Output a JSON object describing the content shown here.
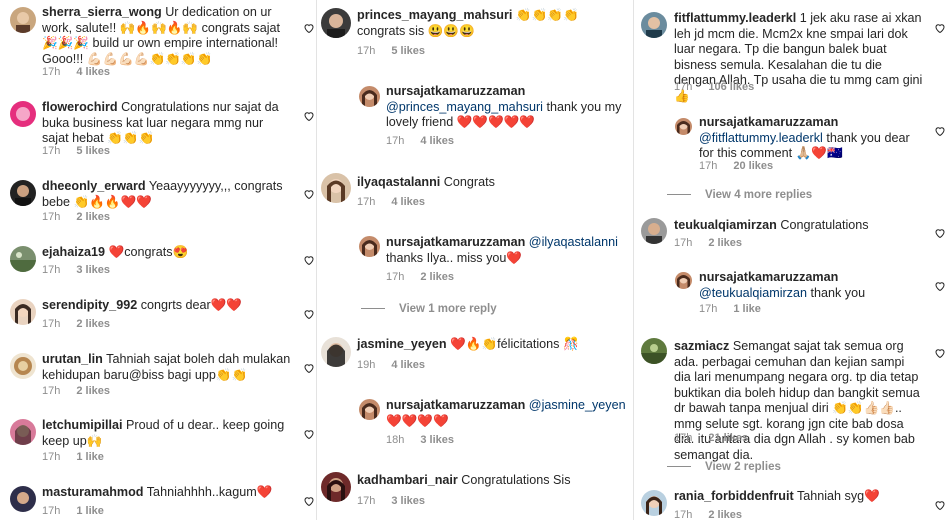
{
  "colors": {
    "text": "#262626",
    "secondary": "#8e8e8e",
    "mention": "#00376b",
    "emoji_heart": "#e0245e"
  },
  "col1": [
    {
      "user": "sherra_sierra_wong",
      "text": "Ur dedication on ur work, salute!! 🙌🔥🙌🔥🙌 congrats sajat 🎉🎉🎉 build ur own empire international! Gooo!!! 💪🏻💪🏻💪🏻💪🏻👏👏👏👏",
      "time": "17h",
      "likes": "4 likes"
    },
    {
      "user": "flowerochird",
      "text": "Congratulations nur sajat da buka business kat luar negara mmg nur sajat hebat 👏👏👏",
      "time": "17h",
      "likes": "5 likes"
    },
    {
      "user": "dheeonly_erward",
      "text": "Yeaayyyyyyy,,, congrats bebe 👏🔥🔥❤️❤️",
      "time": "17h",
      "likes": "2 likes"
    },
    {
      "user": "ejahaiza19",
      "text": "❤️congrats😍",
      "time": "17h",
      "likes": "3 likes"
    },
    {
      "user": "serendipity_992",
      "text": "congrts dear❤️❤️",
      "time": "17h",
      "likes": "2 likes"
    },
    {
      "user": "urutan_lin",
      "text": "Tahniah sajat boleh dah mulakan kehidupan baru@biss bagi upp👏👏",
      "time": "17h",
      "likes": "2 likes"
    },
    {
      "user": "letchumipillai",
      "text": "Proud of u dear.. keep going keep up🙌",
      "time": "17h",
      "likes": "1 like"
    },
    {
      "user": "masturamahmod",
      "text": "Tahniahhhh..kagum❤️",
      "time": "17h",
      "likes": "1 like"
    }
  ],
  "col2": {
    "c_princes": {
      "user": "princes_mayang_mahsuri",
      "text": "👏👏👏👏 congrats sis 😃😃😃",
      "time": "17h",
      "likes": "5 likes"
    },
    "r_princes": {
      "user": "nursajatkamaruzzaman",
      "mention": "@princes_mayang_mahsuri",
      "text": " thank you my lovely friend ❤️❤️❤️❤️❤️",
      "time": "17h",
      "likes": "4 likes"
    },
    "c_ilya": {
      "user": "ilyaqastalanni",
      "text": "Congrats",
      "time": "17h",
      "likes": "4 likes"
    },
    "r_ilya": {
      "user": "nursajatkamaruzzaman",
      "mention": "@ilyaqastalanni",
      "text": " thanks Ilya.. miss you❤️",
      "time": "17h",
      "likes": "2 likes"
    },
    "view_ilya": "View 1 more reply",
    "c_jasmine": {
      "user": "jasmine_yeyen",
      "text": "❤️🔥👏félicitations 🎊",
      "time": "19h",
      "likes": "4 likes"
    },
    "r_jasmine": {
      "user": "nursajatkamaruzzaman",
      "mention": "@jasmine_yeyen",
      "text": " ❤️❤️❤️❤️",
      "time": "18h",
      "likes": "3 likes"
    },
    "c_kadhambari": {
      "user": "kadhambari_nair",
      "text": "Congratulations Sis",
      "time": "17h",
      "likes": "3 likes"
    }
  },
  "col3": {
    "c_fitflat": {
      "user": "fitflattummy.leaderkl",
      "text": "1 jek aku rase ai xkan leh jd mcm die. Mcm2x kne smpai lari dok luar negara. Tp die bangun balek buat bisness semula. Kesalahan die tu die dengan Allah. Tp usaha die tu mmg cam gini 👍",
      "time": "17h",
      "likes": "106 likes"
    },
    "r_fitflat": {
      "user": "nursajatkamaruzzaman",
      "mention": "@fitflattummy.leaderkl",
      "text": " thank you dear for this comment 🙏🏼❤️🇦🇺",
      "time": "17h",
      "likes": "20 likes"
    },
    "view_fitflat": "View 4 more replies",
    "c_teuku": {
      "user": "teukualqiamirzan",
      "text": "Congratulations",
      "time": "17h",
      "likes": "2 likes"
    },
    "r_teuku": {
      "user": "nursajatkamaruzzaman",
      "mention": "@teukualqiamirzan",
      "text": " thank you",
      "time": "17h",
      "likes": "1 like"
    },
    "c_sazmi": {
      "user": "sazmiacz",
      "text": "Semangat sajat tak semua org ada. perbagai cemuhan dan kejian sampi dia lari menumpang negara org. tp dia tetap buktikan dia boleh hidup dan bangkit semua dr bawah tanpa menjual diri 👏👏👍🏻👍🏻.. mmg selute sgt. korang jgn cite bab dosa dia. itu antara dia dgn Allah . sy komen bab semangat dia.",
      "time": "17h",
      "likes": "21 likes"
    },
    "view_sazmi": "View 2 replies",
    "c_rania": {
      "user": "rania_forbiddenfruit",
      "text": "Tahniah syg❤️",
      "time": "17h",
      "likes": "2 likes"
    }
  }
}
